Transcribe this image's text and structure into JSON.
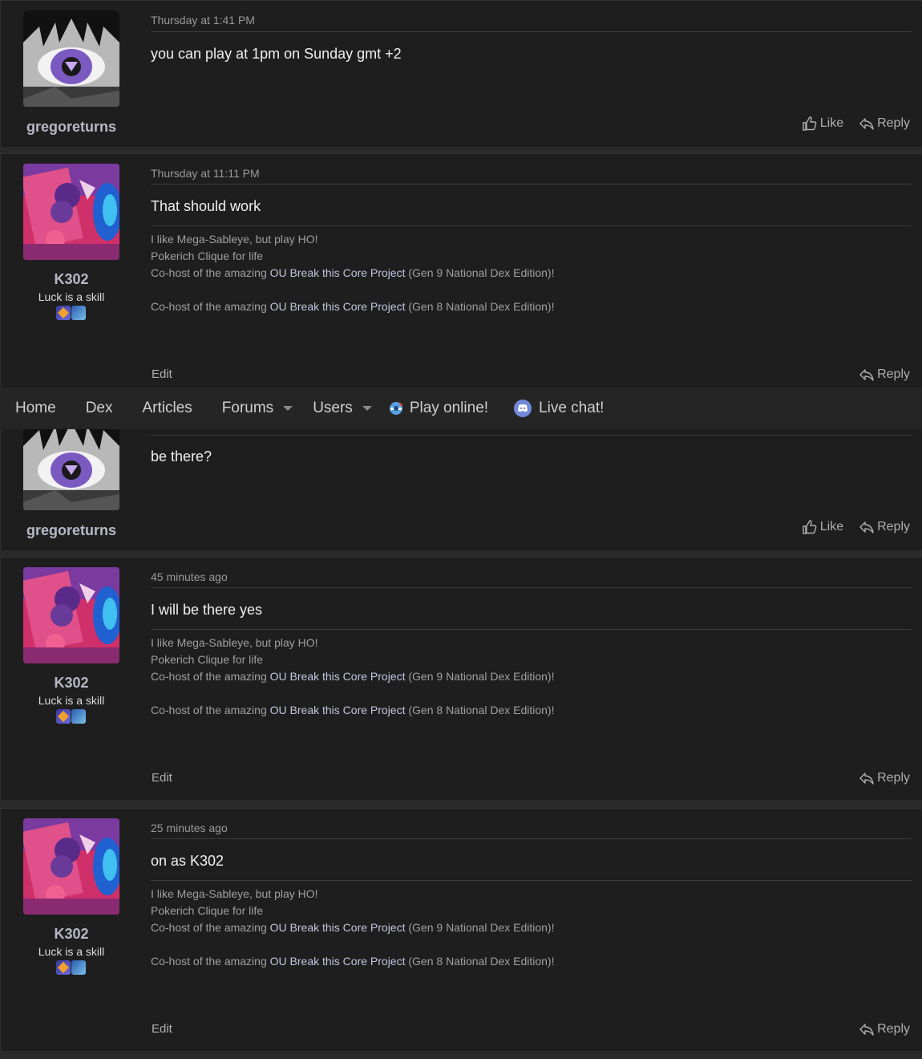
{
  "navbar": {
    "items": [
      {
        "label": "Home"
      },
      {
        "label": "Dex"
      },
      {
        "label": "Articles"
      },
      {
        "label": "Forums",
        "dropdown": true
      },
      {
        "label": "Users",
        "dropdown": true
      },
      {
        "label": "Play online!",
        "icon": "showdown-icon"
      },
      {
        "label": "Live chat!",
        "icon": "discord-icon"
      }
    ]
  },
  "actions": {
    "like": "Like",
    "reply": "Reply",
    "edit": "Edit"
  },
  "users": {
    "gregoreturns": {
      "name": "gregoreturns"
    },
    "k302": {
      "name": "K302",
      "title": "Luck is a skill"
    }
  },
  "signature": {
    "line1": "I like Mega-Sableye, but play HO!",
    "line2": "Pokerich Clique for life",
    "cohost_prefix": "Co-host of the amazing ",
    "cohost_link": "OU Break this Core Project",
    "gen9_suffix": " (Gen 9 National Dex Edition)!",
    "gen8_suffix": " (Gen 8 National Dex Edition)!"
  },
  "posts": [
    {
      "timestamp": "Thursday at 1:41 PM",
      "message": "you can play at 1pm on Sunday gmt +2"
    },
    {
      "timestamp": "Thursday at 11:11 PM",
      "message": "That should work"
    },
    {
      "timestamp": "",
      "message": "be there?"
    },
    {
      "timestamp": "45 minutes ago",
      "message": "I will be there yes"
    },
    {
      "timestamp": "25 minutes ago",
      "message": "on as K302"
    }
  ]
}
